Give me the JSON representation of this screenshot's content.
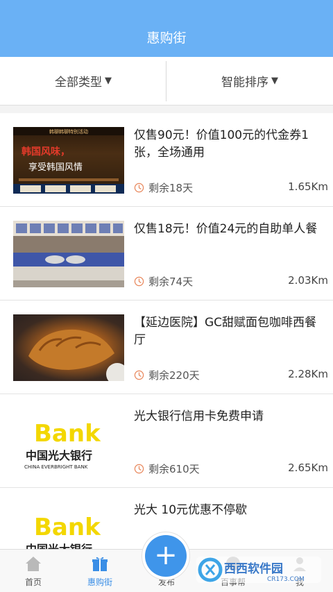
{
  "header": {
    "title": "惠购街",
    "bg_color": "#6ab1f5"
  },
  "filters": [
    {
      "label": "全部类型",
      "arrow": "▼"
    },
    {
      "label": "智能排序",
      "arrow": "▼"
    }
  ],
  "deals": [
    {
      "title": "仅售90元！价值100元的代金券1张，全场通用",
      "remain": "剩余18天",
      "distance": "1.65Km",
      "thumb_text_1": "韩国风味，",
      "thumb_text_2": "享受韩国风情",
      "thumb_banner": "韩聊韩聊特别活动"
    },
    {
      "title": "仅售18元！价值24元的自助单人餐",
      "remain": "剩余74天",
      "distance": "2.03Km"
    },
    {
      "title": "【延边医院】GC甜赋面包咖啡西餐厅",
      "remain": "剩余220天",
      "distance": "2.28Km"
    },
    {
      "title": "光大银行信用卡免费申请",
      "remain": "剩余610天",
      "distance": "2.65Km",
      "logo_word": "Bank",
      "logo_cn": "中国光大银行",
      "logo_en": "CHINA EVERBRIGHT BANK"
    },
    {
      "title": "光大 10元优惠不停歇",
      "logo_word": "Bank",
      "logo_cn": "中国光大银行"
    }
  ],
  "bottom_nav": [
    {
      "label": "首页",
      "icon": "home-icon"
    },
    {
      "label": "惠购街",
      "icon": "gift-icon",
      "active": true
    },
    {
      "label": "发布",
      "icon": "plus-icon"
    },
    {
      "label": "百事帮",
      "icon": "help-icon"
    },
    {
      "label": "我",
      "icon": "user-icon"
    }
  ],
  "publish": {
    "symbol": "+"
  },
  "watermark": {
    "brand": "西西软件园",
    "site": "CR173.COM"
  },
  "colors": {
    "accent": "#3f95ea",
    "clock": "#e8865a",
    "bank_yellow": "#f3d700",
    "bank_purple": "#6c2a7d"
  }
}
